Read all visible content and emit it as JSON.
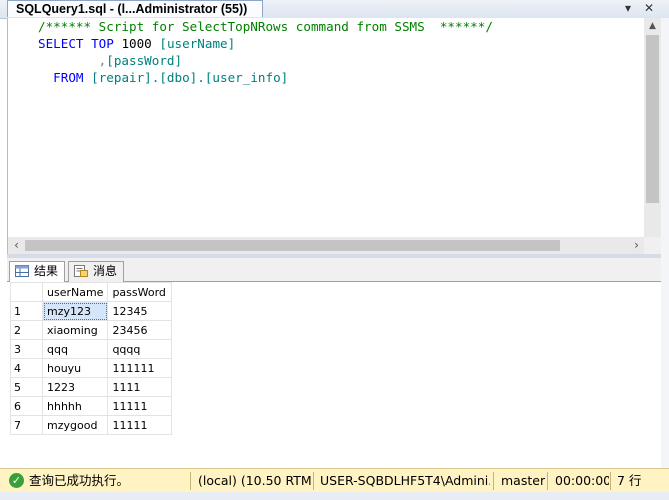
{
  "tab": {
    "title": "SQLQuery1.sql - (l...Administrator (55))",
    "dropdown_glyph": "▾",
    "close_glyph": "✕"
  },
  "editor": {
    "lines": [
      {
        "comment": "/****** Script for SelectTopNRows command from SSMS  ******/"
      },
      {
        "kw1": "SELECT",
        "kw2": "TOP",
        "num": "1000",
        "col": "[userName]"
      },
      {
        "comma": ",",
        "col": "[passWord]"
      },
      {
        "kw": "FROM",
        "obj": "[repair].[dbo].[user_info]"
      }
    ]
  },
  "result_tabs": [
    {
      "label": "结果",
      "icon": "grid-icon",
      "active": true
    },
    {
      "label": "消息",
      "icon": "message-icon",
      "active": false
    }
  ],
  "grid": {
    "columns": [
      "userName",
      "passWord"
    ],
    "rows": [
      {
        "n": "1",
        "userName": "mzy123",
        "passWord": "12345"
      },
      {
        "n": "2",
        "userName": "xiaoming",
        "passWord": "23456"
      },
      {
        "n": "3",
        "userName": "qqq",
        "passWord": "qqqq"
      },
      {
        "n": "4",
        "userName": "houyu",
        "passWord": "111111"
      },
      {
        "n": "5",
        "userName": "1223",
        "passWord": "1111"
      },
      {
        "n": "6",
        "userName": "hhhhh",
        "passWord": "11111"
      },
      {
        "n": "7",
        "userName": "mzygood",
        "passWord": "11111"
      }
    ]
  },
  "status": {
    "message": "查询已成功执行。",
    "server": "(local) (10.50 RTM)",
    "user": "USER-SQBDLHF5T4\\Admini...",
    "database": "master",
    "elapsed": "00:00:00",
    "rows": "7 行",
    "icon": "success-check-icon",
    "background_color": "#fff3c3"
  },
  "colors": {
    "keyword": "#0000ff",
    "comment": "#008000",
    "identifier": "#008080",
    "selection": "#d5e6fa"
  }
}
